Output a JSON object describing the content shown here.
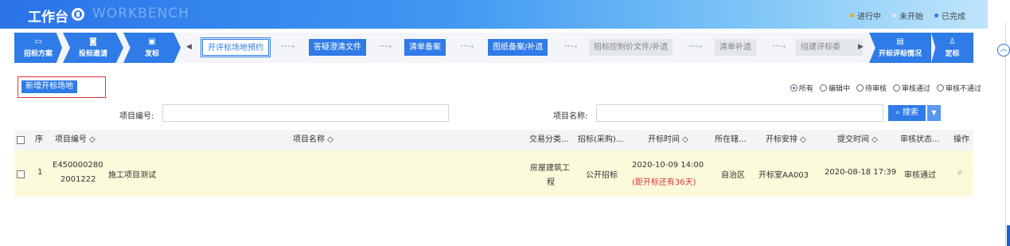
{
  "header": {
    "title": "工作台",
    "subtitle": "WORKBENCH",
    "legend": [
      {
        "label": "进行中",
        "color": "#f5a623"
      },
      {
        "label": "未开始",
        "color": "#e6e9ee"
      },
      {
        "label": "已完成",
        "color": "#2f7be8"
      }
    ]
  },
  "steps": {
    "left": [
      {
        "icon": "monitor-icon",
        "glyph": "▭",
        "label": "招标方案"
      },
      {
        "icon": "bag-icon",
        "glyph": "◙",
        "label": "投标邀请"
      },
      {
        "icon": "doc-icon",
        "glyph": "▣",
        "label": "发标"
      }
    ],
    "sub": [
      {
        "label": "开评标场地预约",
        "status": "active"
      },
      {
        "label": "答疑澄清文件",
        "status": "done"
      },
      {
        "label": "清单备案",
        "status": "done"
      },
      {
        "label": "图纸备案/补遗",
        "status": "done"
      },
      {
        "label": "招标控制价文件/补遗",
        "status": "pending"
      },
      {
        "label": "清单补遗",
        "status": "pending"
      },
      {
        "label": "组建评标委",
        "status": "pending"
      }
    ],
    "right": [
      {
        "icon": "report-icon",
        "glyph": "▤",
        "label": "开标评标情况"
      },
      {
        "icon": "user-icon",
        "glyph": "♙",
        "label": "定标"
      }
    ]
  },
  "toolbar": {
    "add_label": "新增开标场地",
    "filters": [
      {
        "label": "所有",
        "checked": true
      },
      {
        "label": "编辑中",
        "checked": false
      },
      {
        "label": "待审核",
        "checked": false
      },
      {
        "label": "审核通过",
        "checked": false
      },
      {
        "label": "审核不通过",
        "checked": false
      }
    ]
  },
  "search": {
    "code_label": "项目编号:",
    "name_label": "项目名称:",
    "button_label": "搜索",
    "code_value": "",
    "name_value": ""
  },
  "table": {
    "columns": [
      "序",
      "项目编号 ◇",
      "项目名称 ◇",
      "交易分类...",
      "招标(采购)...",
      "开标时间 ◇",
      "所在辖...",
      "开标安排 ◇",
      "提交时间 ◇",
      "审核状态...",
      "操作"
    ],
    "rows": [
      {
        "seq": "1",
        "code_line1": "E450000280",
        "code_line2": "2001222",
        "name": "施工项目测试",
        "category_line1": "房屋建筑工",
        "category_line2": "程",
        "method": "公开招标",
        "open_time": "2020-10-09 14:00",
        "countdown": "(距开标还有36天)",
        "region": "自治区",
        "arrangement": "开标室AA003",
        "submit_time": "2020-08-18 17:39",
        "status": "审核通过"
      }
    ]
  }
}
